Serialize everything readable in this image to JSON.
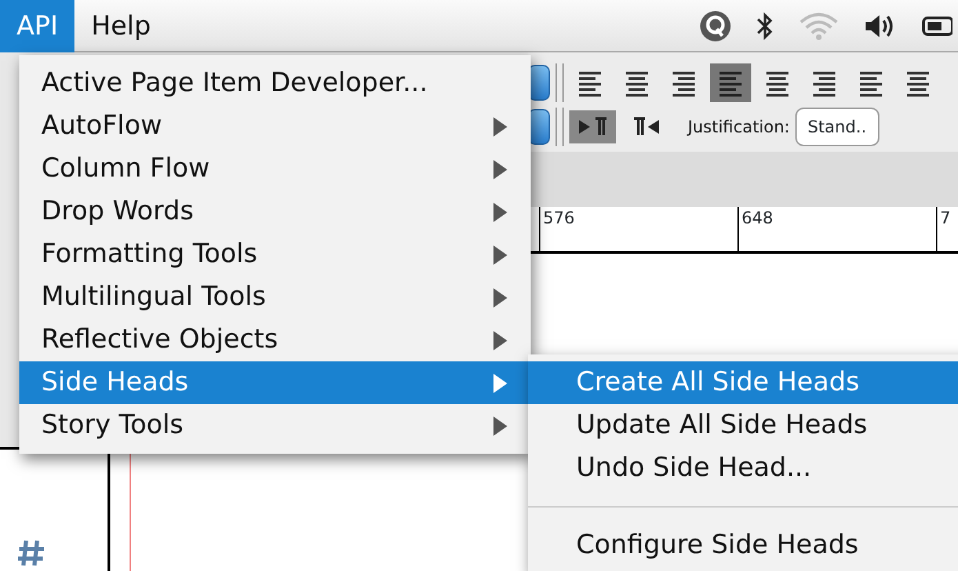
{
  "menubar": {
    "menus": [
      {
        "label": "API",
        "selected": true
      },
      {
        "label": "Help",
        "selected": false
      }
    ]
  },
  "toolbar": {
    "alignments": [
      {
        "selected": false
      },
      {
        "selected": false
      },
      {
        "selected": false
      },
      {
        "selected": true
      },
      {
        "selected": false
      },
      {
        "selected": false
      },
      {
        "selected": false
      },
      {
        "selected": false
      }
    ],
    "directions": [
      {
        "selected": true
      },
      {
        "selected": false
      }
    ],
    "justification_label": "Justification:",
    "justification_value": "Stand.."
  },
  "ruler": {
    "labels": [
      "576",
      "648",
      "7"
    ]
  },
  "menu": {
    "items": [
      {
        "label": "Active Page Item Developer...",
        "submenu": false,
        "selected": false
      },
      {
        "label": "AutoFlow",
        "submenu": true,
        "selected": false
      },
      {
        "label": "Column Flow",
        "submenu": true,
        "selected": false
      },
      {
        "label": "Drop Words",
        "submenu": true,
        "selected": false
      },
      {
        "label": "Formatting Tools",
        "submenu": true,
        "selected": false
      },
      {
        "label": "Multilingual Tools",
        "submenu": true,
        "selected": false
      },
      {
        "label": "Reflective Objects",
        "submenu": true,
        "selected": false
      },
      {
        "label": "Side Heads",
        "submenu": true,
        "selected": true
      },
      {
        "label": "Story Tools",
        "submenu": true,
        "selected": false
      }
    ]
  },
  "submenu": {
    "items": [
      {
        "kind": "item",
        "label": "Create All Side Heads",
        "selected": true
      },
      {
        "kind": "item",
        "label": "Update All Side Heads",
        "selected": false
      },
      {
        "kind": "item",
        "label": "Undo Side Head...",
        "selected": false
      },
      {
        "kind": "separator"
      },
      {
        "kind": "item",
        "label": "Configure Side Heads",
        "selected": false
      }
    ]
  }
}
